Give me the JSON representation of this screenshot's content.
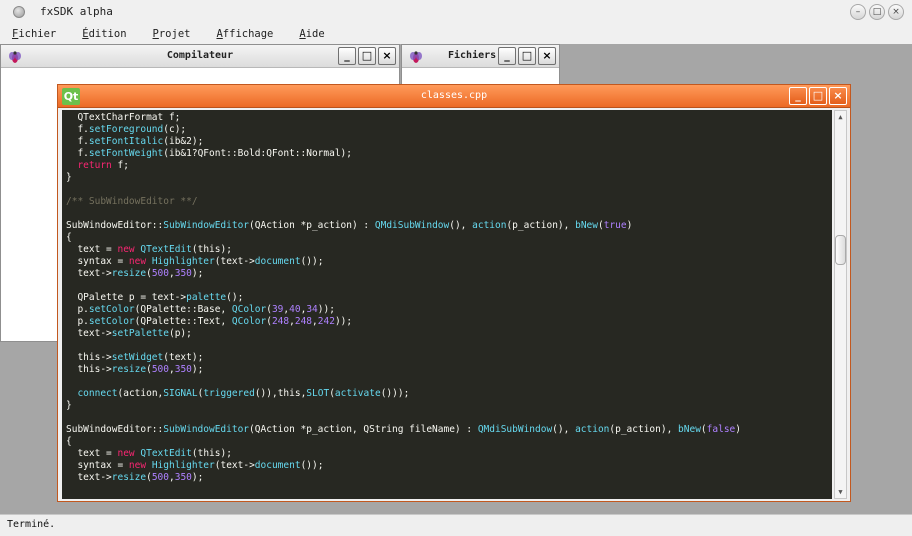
{
  "app": {
    "title": "fxSDK alpha"
  },
  "menu": [
    {
      "mnemonic": "F",
      "rest": "ichier"
    },
    {
      "mnemonic": "É",
      "rest": "dition"
    },
    {
      "mnemonic": "P",
      "rest": "rojet"
    },
    {
      "mnemonic": "A",
      "rest": "ffichage"
    },
    {
      "mnemonic": "A",
      "rest": "ide"
    }
  ],
  "windows": {
    "compiler": {
      "title": "Compilateur"
    },
    "files": {
      "title": "Fichiers"
    },
    "editor": {
      "title": "classes.cpp",
      "logo": "Qt"
    }
  },
  "window_buttons": {
    "minimize": "_",
    "maximize": "□",
    "close": "×"
  },
  "code_lines": [
    [
      [
        "  QTextCharFormat f;",
        ""
      ]
    ],
    [
      [
        "  f.",
        ""
      ],
      [
        "setForeground",
        "fn"
      ],
      [
        "(c);",
        ""
      ]
    ],
    [
      [
        "  f.",
        ""
      ],
      [
        "setFontItalic",
        "fn"
      ],
      [
        "(ib&2);",
        ""
      ]
    ],
    [
      [
        "  f.",
        ""
      ],
      [
        "setFontWeight",
        "fn"
      ],
      [
        "(ib&1?QFont::Bold:QFont::Normal);",
        ""
      ]
    ],
    [
      [
        "  ",
        ""
      ],
      [
        "return",
        "kw"
      ],
      [
        " f;",
        ""
      ]
    ],
    [
      [
        "}",
        ""
      ]
    ],
    [
      [
        "",
        ""
      ]
    ],
    [
      [
        "/** SubWindowEditor **/",
        "com"
      ]
    ],
    [
      [
        "",
        ""
      ]
    ],
    [
      [
        "SubWindowEditor::",
        ""
      ],
      [
        "SubWindowEditor",
        "fn"
      ],
      [
        "(QAction *p_action) : ",
        ""
      ],
      [
        "QMdiSubWindow",
        "fn"
      ],
      [
        "(), ",
        ""
      ],
      [
        "action",
        "fn"
      ],
      [
        "(p_action), ",
        ""
      ],
      [
        "bNew",
        "fn"
      ],
      [
        "(",
        ""
      ],
      [
        "true",
        "num"
      ],
      [
        ")",
        ""
      ]
    ],
    [
      [
        "{",
        ""
      ]
    ],
    [
      [
        "  text = ",
        ""
      ],
      [
        "new",
        "kw"
      ],
      [
        " ",
        ""
      ],
      [
        "QTextEdit",
        "fn"
      ],
      [
        "(this);",
        ""
      ]
    ],
    [
      [
        "  syntax = ",
        ""
      ],
      [
        "new",
        "kw"
      ],
      [
        " ",
        ""
      ],
      [
        "Highlighter",
        "fn"
      ],
      [
        "(text->",
        ""
      ],
      [
        "document",
        "fn"
      ],
      [
        "());",
        ""
      ]
    ],
    [
      [
        "  text->",
        ""
      ],
      [
        "resize",
        "fn"
      ],
      [
        "(",
        ""
      ],
      [
        "500",
        "num"
      ],
      [
        ",",
        ""
      ],
      [
        "350",
        "num"
      ],
      [
        ");",
        ""
      ]
    ],
    [
      [
        "",
        ""
      ]
    ],
    [
      [
        "  QPalette p = text->",
        ""
      ],
      [
        "palette",
        "fn"
      ],
      [
        "();",
        ""
      ]
    ],
    [
      [
        "  p.",
        ""
      ],
      [
        "setColor",
        "fn"
      ],
      [
        "(QPalette::Base, ",
        ""
      ],
      [
        "QColor",
        "fn"
      ],
      [
        "(",
        ""
      ],
      [
        "39",
        "num"
      ],
      [
        ",",
        ""
      ],
      [
        "40",
        "num"
      ],
      [
        ",",
        ""
      ],
      [
        "34",
        "num"
      ],
      [
        "));",
        ""
      ]
    ],
    [
      [
        "  p.",
        ""
      ],
      [
        "setColor",
        "fn"
      ],
      [
        "(QPalette::Text, ",
        ""
      ],
      [
        "QColor",
        "fn"
      ],
      [
        "(",
        ""
      ],
      [
        "248",
        "num"
      ],
      [
        ",",
        ""
      ],
      [
        "248",
        "num"
      ],
      [
        ",",
        ""
      ],
      [
        "242",
        "num"
      ],
      [
        "));",
        ""
      ]
    ],
    [
      [
        "  text->",
        ""
      ],
      [
        "setPalette",
        "fn"
      ],
      [
        "(p);",
        ""
      ]
    ],
    [
      [
        "",
        ""
      ]
    ],
    [
      [
        "  this->",
        ""
      ],
      [
        "setWidget",
        "fn"
      ],
      [
        "(text);",
        ""
      ]
    ],
    [
      [
        "  this->",
        ""
      ],
      [
        "resize",
        "fn"
      ],
      [
        "(",
        ""
      ],
      [
        "500",
        "num"
      ],
      [
        ",",
        ""
      ],
      [
        "350",
        "num"
      ],
      [
        ");",
        ""
      ]
    ],
    [
      [
        "",
        ""
      ]
    ],
    [
      [
        "  ",
        ""
      ],
      [
        "connect",
        "fn"
      ],
      [
        "(action,",
        ""
      ],
      [
        "SIGNAL",
        "fn"
      ],
      [
        "(",
        ""
      ],
      [
        "triggered",
        "fn"
      ],
      [
        "()),this,",
        ""
      ],
      [
        "SLOT",
        "fn"
      ],
      [
        "(",
        ""
      ],
      [
        "activate",
        "fn"
      ],
      [
        "()));",
        ""
      ]
    ],
    [
      [
        "}",
        ""
      ]
    ],
    [
      [
        "",
        ""
      ]
    ],
    [
      [
        "SubWindowEditor::",
        ""
      ],
      [
        "SubWindowEditor",
        "fn"
      ],
      [
        "(QAction *p_action, QString fileName) : ",
        ""
      ],
      [
        "QMdiSubWindow",
        "fn"
      ],
      [
        "(), ",
        ""
      ],
      [
        "action",
        "fn"
      ],
      [
        "(p_action), ",
        ""
      ],
      [
        "bNew",
        "fn"
      ],
      [
        "(",
        ""
      ],
      [
        "false",
        "num"
      ],
      [
        ")",
        ""
      ]
    ],
    [
      [
        "{",
        ""
      ]
    ],
    [
      [
        "  text = ",
        ""
      ],
      [
        "new",
        "kw"
      ],
      [
        " ",
        ""
      ],
      [
        "QTextEdit",
        "fn"
      ],
      [
        "(this);",
        ""
      ]
    ],
    [
      [
        "  syntax = ",
        ""
      ],
      [
        "new",
        "kw"
      ],
      [
        " ",
        ""
      ],
      [
        "Highlighter",
        "fn"
      ],
      [
        "(text->",
        ""
      ],
      [
        "document",
        "fn"
      ],
      [
        "());",
        ""
      ]
    ],
    [
      [
        "  text->",
        ""
      ],
      [
        "resize",
        "fn"
      ],
      [
        "(",
        ""
      ],
      [
        "500",
        "num"
      ],
      [
        ",",
        ""
      ],
      [
        "350",
        "num"
      ],
      [
        ");",
        ""
      ]
    ]
  ],
  "status": {
    "text": "Terminé."
  },
  "colors": {
    "editor_bg": "#272822",
    "editor_fg": "#f8f8f2",
    "keyword": "#f92672",
    "function": "#66d9ef",
    "number": "#ae81ff",
    "comment": "#75715e",
    "active_titlebar": "#ec6a25",
    "mdi_background": "#a6a6a6"
  }
}
